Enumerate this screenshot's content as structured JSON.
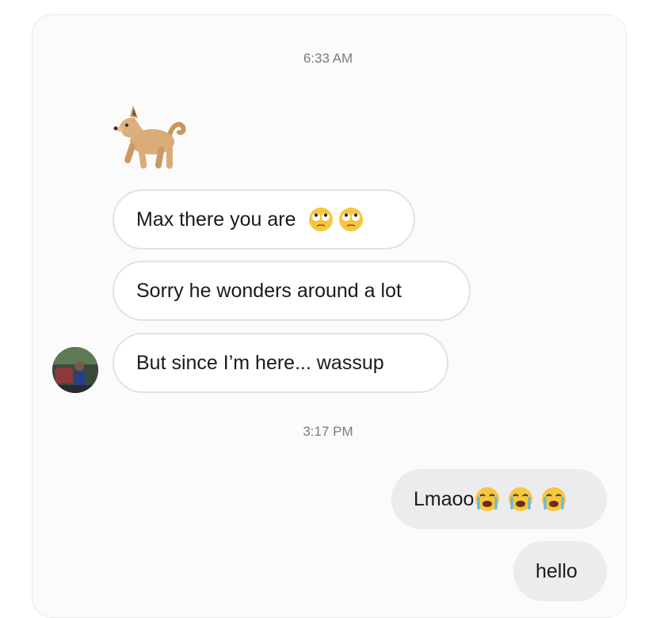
{
  "thread": {
    "timestamp_1": "6:33 AM",
    "timestamp_2": "3:17 PM",
    "sticker": "dog-emoji",
    "incoming": [
      {
        "text": "Max there you are",
        "emojis": [
          "eye-roll-emoji",
          "eye-roll-emoji"
        ]
      },
      {
        "text": "Sorry he wonders around a lot"
      },
      {
        "text": "But since I’m here... wassup"
      }
    ],
    "outgoing": [
      {
        "text": "Lmaoo",
        "emojis": [
          "crying-emoji",
          "crying-emoji",
          "crying-emoji"
        ]
      },
      {
        "text": "hello"
      }
    ]
  },
  "colors": {
    "incoming_bubble": "#ffffff",
    "incoming_border": "#e2e2e6",
    "outgoing_bubble": "#ececef",
    "timestamp": "#7a7a80"
  }
}
